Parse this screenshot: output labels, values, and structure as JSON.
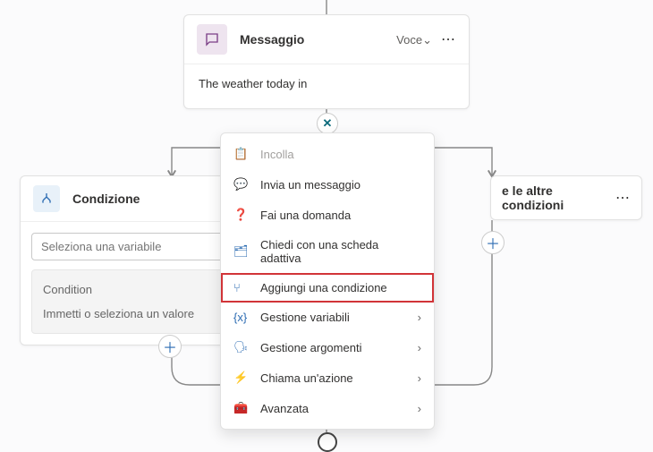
{
  "message_node": {
    "title": "Messaggio",
    "voice_label": "Voce",
    "body_text": "The weather today in"
  },
  "close_button": {
    "glyph": "✕"
  },
  "condition_node": {
    "title": "Condizione",
    "variable_placeholder": "Seleziona una variabile",
    "condition_label": "Condition",
    "value_placeholder": "Immetti o seleziona un valore"
  },
  "other_node": {
    "title": "e le altre condizioni"
  },
  "context_menu": {
    "items": [
      {
        "label": "Incolla",
        "icon": "paste",
        "disabled": true,
        "submenu": false,
        "highlighted": false
      },
      {
        "label": "Invia un messaggio",
        "icon": "chat",
        "disabled": false,
        "submenu": false,
        "highlighted": false
      },
      {
        "label": "Fai una domanda",
        "icon": "question",
        "disabled": false,
        "submenu": false,
        "highlighted": false
      },
      {
        "label": "Chiedi con una scheda adattiva",
        "icon": "card",
        "disabled": false,
        "submenu": false,
        "highlighted": false
      },
      {
        "label": "Aggiungi una condizione",
        "icon": "branch",
        "disabled": false,
        "submenu": false,
        "highlighted": true
      },
      {
        "label": "Gestione variabili",
        "icon": "var",
        "disabled": false,
        "submenu": true,
        "highlighted": false
      },
      {
        "label": "Gestione argomenti",
        "icon": "topic",
        "disabled": false,
        "submenu": true,
        "highlighted": false
      },
      {
        "label": "Chiama un'azione",
        "icon": "bolt",
        "disabled": false,
        "submenu": true,
        "highlighted": false
      },
      {
        "label": "Avanzata",
        "icon": "toolbox",
        "disabled": false,
        "submenu": true,
        "highlighted": false
      }
    ]
  },
  "icons": {
    "paste": "📋",
    "chat": "💬",
    "question": "❓",
    "card": "🗂",
    "branch": "⑂",
    "var": "{x}",
    "topic": "🗣",
    "bolt": "⚡",
    "toolbox": "🧰"
  },
  "glyphs": {
    "plus": "＋",
    "chevron_down": "⌄",
    "chevron_right": "›",
    "dots": "⋯"
  }
}
